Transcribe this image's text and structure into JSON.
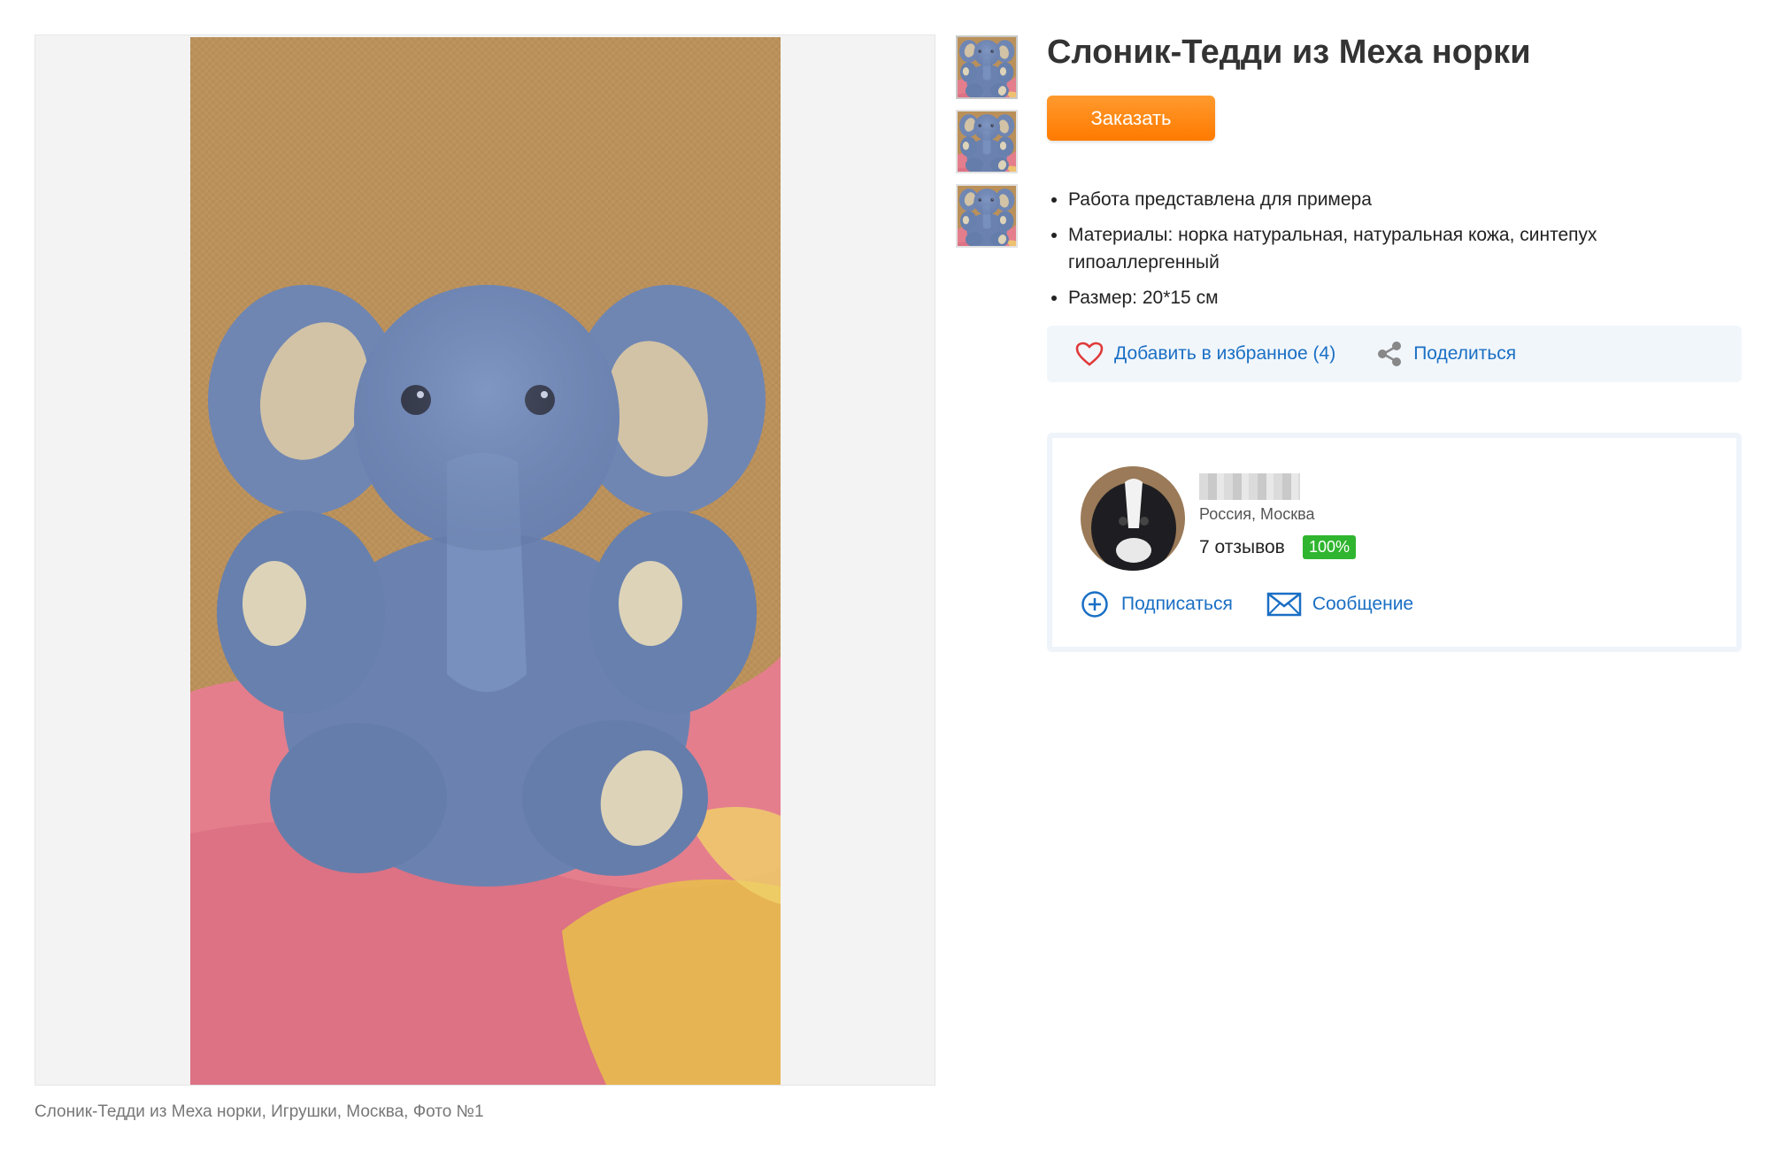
{
  "product": {
    "title": "Слоник-Тедди из Меха норки",
    "order_label": "Заказать",
    "features": [
      "Работа представлена для примера",
      "Материалы:  норка натуральная, натуральная кожа, синтепух гипоаллергенный",
      "Размер:  20*15 см"
    ],
    "caption": "Слоник-Тедди из Меха норки, Игрушки, Москва, Фото №1"
  },
  "actions": {
    "favorite_label": "Добавить в избранное (4)",
    "share_label": "Поделиться"
  },
  "seller": {
    "location": "Россия, Москва",
    "reviews": "7 отзывов",
    "rating": "100%",
    "subscribe_label": "Подписаться",
    "message_label": "Сообщение"
  },
  "colors": {
    "accent_orange": "#ff8a10",
    "link_blue": "#1a6fc4",
    "rating_green": "#2fb52f",
    "heart_red": "#e03a3a"
  },
  "icons": [
    "heart-icon",
    "share-icon",
    "plus-circle-icon",
    "envelope-icon"
  ]
}
